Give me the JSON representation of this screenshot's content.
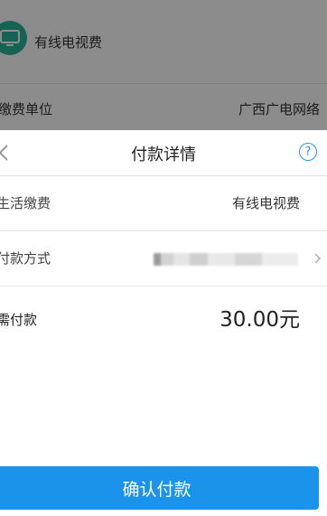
{
  "background": {
    "service_title": "有线电视费",
    "biller_label": "缴费单位",
    "biller_value": "广西广电网络",
    "icon": "tv-icon",
    "accent": "#29b59b"
  },
  "sheet": {
    "title": "付款详情",
    "back_icon": "chevron-left-icon",
    "help_icon": "help-icon",
    "help_glyph": "?",
    "rows": [
      {
        "label": "生活缴费",
        "value": "有线电视费"
      },
      {
        "label": "付款方式",
        "value": ""
      }
    ],
    "amount_label": "需付款",
    "amount_value": "30.00元",
    "confirm_label": "确认付款",
    "accent": "#1c93ea"
  }
}
